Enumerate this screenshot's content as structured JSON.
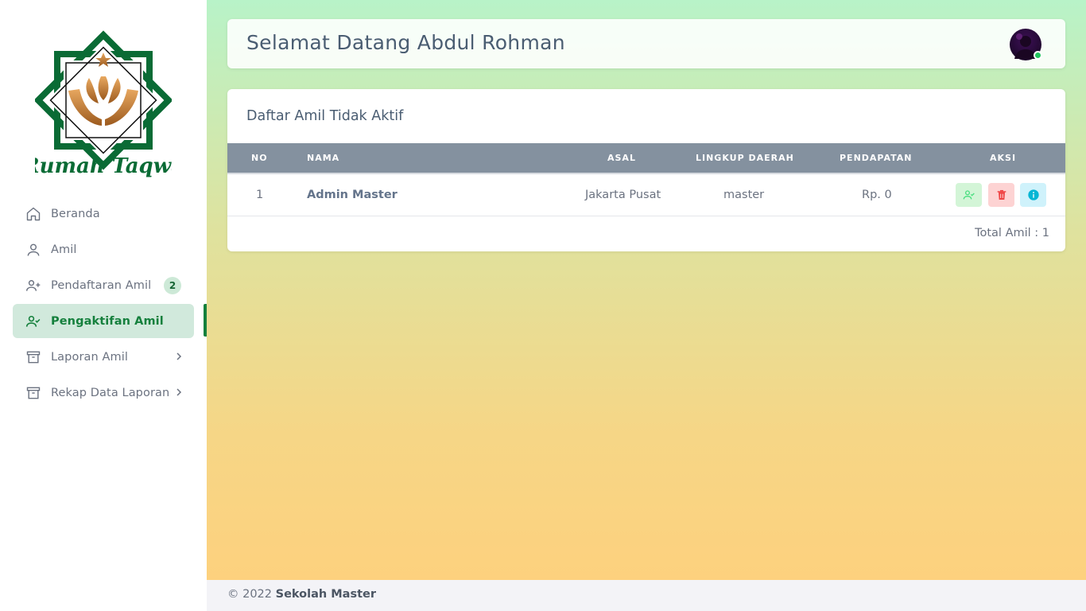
{
  "logo": {
    "text": "Rumah Taqwa"
  },
  "sidebar": {
    "items": [
      {
        "label": "Beranda",
        "icon": "home-icon"
      },
      {
        "label": "Amil",
        "icon": "user-icon"
      },
      {
        "label": "Pendaftaran Amil",
        "icon": "user-plus-icon",
        "badge": "2"
      },
      {
        "label": "Pengaktifan Amil",
        "icon": "user-check-icon",
        "active": true
      },
      {
        "label": "Laporan Amil",
        "icon": "archive-icon",
        "expandable": true
      },
      {
        "label": "Rekap Data Laporan",
        "icon": "archive-icon",
        "expandable": true
      }
    ]
  },
  "header": {
    "title": "Selamat Datang Abdul Rohman"
  },
  "table": {
    "title": "Daftar Amil Tidak Aktif",
    "columns": [
      "NO",
      "NAMA",
      "ASAL",
      "LINGKUP DAERAH",
      "PENDAPATAN",
      "AKSI"
    ],
    "rows": [
      {
        "no": "1",
        "nama": "Admin Master",
        "asal": "Jakarta Pusat",
        "lingkup": "master",
        "pendapatan": "Rp. 0"
      }
    ],
    "total": "Total Amil : 1"
  },
  "footer": {
    "copyright": "© 2022",
    "brand": "Sekolah Master"
  },
  "colors": {
    "accent": "#15803d",
    "header_row": "#84919f",
    "activate": "#4ade80",
    "delete": "#ef4444",
    "info": "#06b6d4"
  }
}
